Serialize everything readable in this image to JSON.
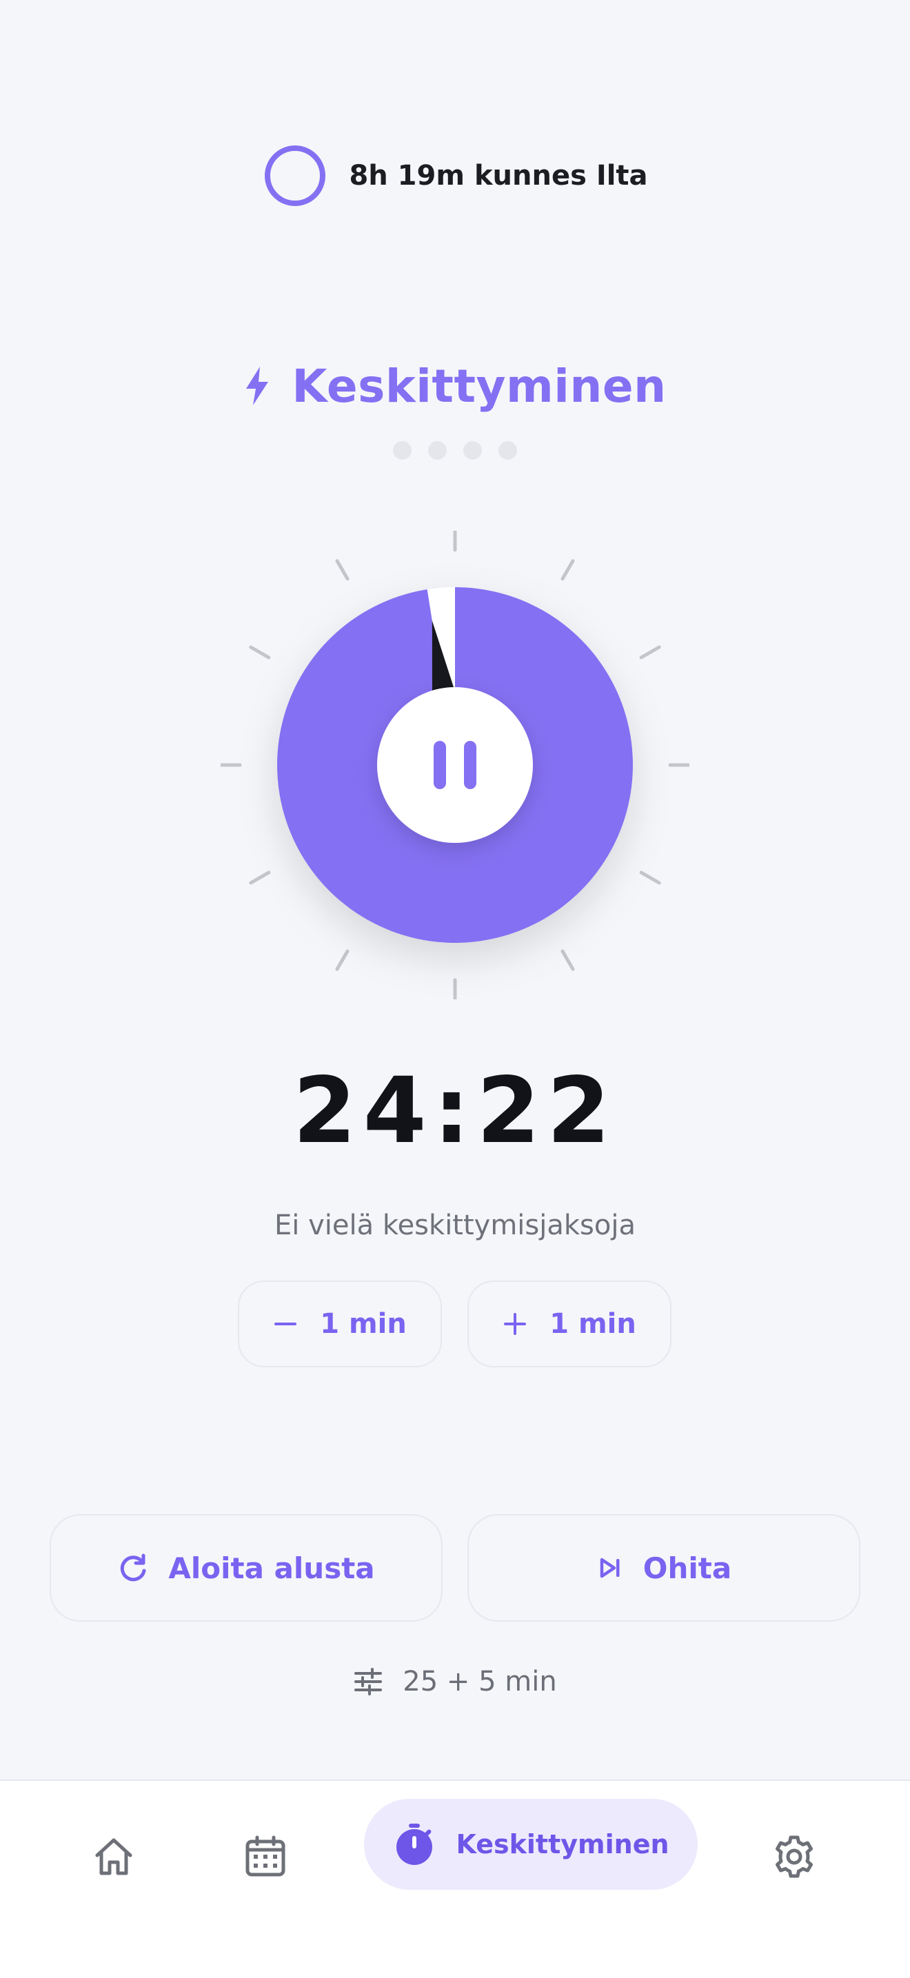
{
  "status": {
    "text": "8h 19m kunnes Ilta"
  },
  "mode": {
    "title": "Keskittyminen",
    "icon": "bolt-icon",
    "dots_total": 4,
    "dots_filled": 0
  },
  "timer": {
    "time": "24:22",
    "remaining_fraction": 0.975,
    "control": "pause"
  },
  "sessions_text": "Ei vielä keskittymisjaksoja",
  "adjust": {
    "minus_label": "1 min",
    "plus_label": "1 min"
  },
  "actions": {
    "restart_label": "Aloita alusta",
    "skip_label": "Ohita"
  },
  "preset_text": "25 + 5 min",
  "nav": {
    "home": "home-icon",
    "calendar": "calendar-icon",
    "focus_label": "Keskittyminen",
    "settings": "gear-icon"
  },
  "colors": {
    "accent": "#8470f2",
    "accent_dark": "#6e56e8",
    "background": "#f5f6fa",
    "text": "#121318"
  }
}
